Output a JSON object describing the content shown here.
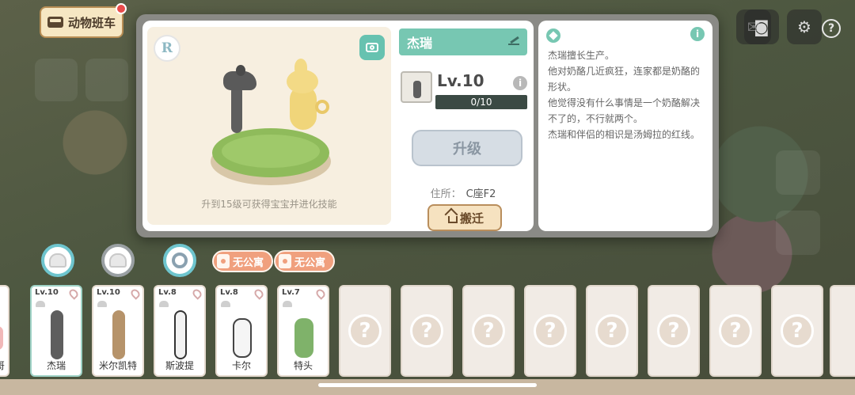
{
  "top": {
    "bus_label": "动物班车",
    "has_notification": true
  },
  "modal": {
    "rarity": "R",
    "stage_hint": "升到15级可获得宝宝并进化技能",
    "name": "杰瑞",
    "level_text": "Lv.10",
    "xp": {
      "text": "0/10",
      "progress": 0
    },
    "upgrade_label": "升级",
    "address_label": "住所：",
    "address_value": "C座F2",
    "move_label": "搬迁",
    "bio": [
      "杰瑞擅长生产。",
      "他对奶酪几近疯狂，连家都是奶酪的形状。",
      "他觉得没有什么事情是一个奶酪解决不了的，不行就两个。",
      "杰瑞和伴侣的相识是汤姆拉的红线。"
    ],
    "colors": {
      "accent": "#77c7b2",
      "card_bg": "#ffffff"
    }
  },
  "tray": {
    "partial_card_name": "哥",
    "cards": [
      {
        "level": "Lv.10",
        "name": "杰瑞"
      },
      {
        "level": "Lv.10",
        "name": "米尔凯特"
      },
      {
        "level": "Lv.8",
        "name": "斯波提"
      },
      {
        "level": "Lv.8",
        "name": "卡尔"
      },
      {
        "level": "Lv.7",
        "name": "特头"
      }
    ],
    "no_apartment_label": "无公寓",
    "empty_slot_symbol": "?"
  }
}
